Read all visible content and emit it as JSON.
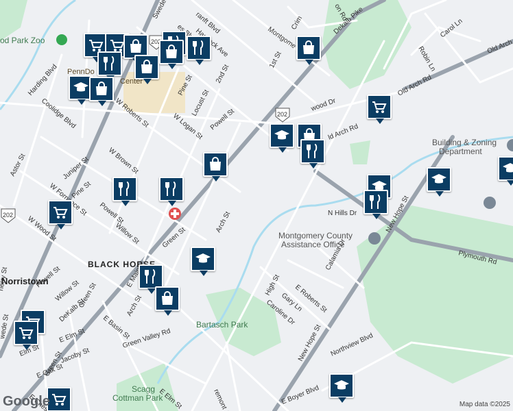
{
  "map": {
    "attribution": "Map data ©2025",
    "logo": "Google"
  },
  "areas": {
    "black_horse": "BLACK HORSE",
    "norristown": "Norristown",
    "penn_dot": "PennDo",
    "penn_dot_center": "Center"
  },
  "pois": {
    "zoo": "od Park Zoo",
    "building_zoning_1": "Building & Zoning",
    "building_zoning_2": "Department",
    "assistance_1": "Montgomery County",
    "assistance_2": "Assistance Office",
    "bartasch_park": "Bartasch Park",
    "scagg_1": "Scagg",
    "scagg_2": "Cottman Park"
  },
  "streets": {
    "s1": "Swede",
    "s2": "ranft Blvd",
    "s3": "es Blvd",
    "s4": "Hancock Ave",
    "s5": "Montgome",
    "s6": "Crim",
    "s7": "on Rd",
    "s8": "Dekalb Pike",
    "s9": "Robin Ln",
    "s10": "Carol Ln",
    "s11": "Old Arch Rd",
    "s12": "Old Arch Rd",
    "s13": "1st St",
    "s14": "2nd St",
    "s15": "Harding Blvd",
    "s16": "Coolidge Blvd",
    "s17": "W Roberts St",
    "s18": "Pine St",
    "s19": "Locust St",
    "s20": "W Logan St",
    "s21": "Powell St",
    "s22": "wood Dr",
    "s23": "ld Arch Rd",
    "s24": "Astor St",
    "s25": "W Brown St",
    "s26": "Juniper St",
    "s27": "Pine St",
    "s28": "W Fornance St",
    "s29": "W Wood St",
    "s30": "Powell St",
    "s31": "Willow St",
    "s32": "Arch St",
    "s33": "Green St",
    "s34": "N Hills Dr",
    "s35": "New Hope St",
    "s36": "Plymouth Rd",
    "s37": "Calamia Dr",
    "s38": "E Roberts St",
    "s39": "High St",
    "s40": "Gary Ln",
    "s41": "Caroline Dr",
    "s42": "Powell St",
    "s43": "Willow St",
    "s44": "DeKalb St",
    "s45": "E Main",
    "s46": "Arch St",
    "s47": "Green St",
    "s48": "E Basin St",
    "s49": "E Elm St",
    "s50": "Green Valley Rd",
    "s51": "Jacoby St",
    "s52": "E Oak St",
    "s53": "E Ches",
    "s54": "Green St",
    "s55": "E Elm St",
    "s56": "remont Ave",
    "s57": "New Hope St",
    "s58": "Northview Blvd",
    "s59": "E Boyer Blvd",
    "s60": "herry St",
    "s61": "wede St",
    "s62": "Elm St"
  },
  "route_shields": [
    "202",
    "202",
    "202",
    "202"
  ],
  "markers": [
    {
      "type": "cart-icon"
    },
    {
      "type": "cart-icon"
    },
    {
      "type": "bag-icon"
    },
    {
      "type": "fork-knife-icon"
    },
    {
      "type": "bag-icon"
    },
    {
      "type": "fork-knife-icon"
    },
    {
      "type": "bag-icon"
    },
    {
      "type": "fork-knife-icon"
    },
    {
      "type": "graduation-cap-icon"
    },
    {
      "type": "bag-icon"
    },
    {
      "type": "bag-icon"
    },
    {
      "type": "graduation-cap-icon"
    },
    {
      "type": "bag-icon"
    },
    {
      "type": "fork-knife-icon"
    },
    {
      "type": "cart-icon"
    },
    {
      "type": "fork-knife-icon"
    },
    {
      "type": "fork-knife-icon"
    },
    {
      "type": "cart-icon"
    },
    {
      "type": "graduation-cap-icon"
    },
    {
      "type": "graduation-cap-icon"
    },
    {
      "type": "graduation-cap-icon"
    },
    {
      "type": "fork-knife-icon"
    },
    {
      "type": "graduation-cap-icon"
    },
    {
      "type": "fork-knife-icon"
    },
    {
      "type": "bag-icon"
    },
    {
      "type": "cart-icon"
    },
    {
      "type": "cart-icon"
    },
    {
      "type": "cart-icon"
    },
    {
      "type": "graduation-cap-icon"
    }
  ]
}
